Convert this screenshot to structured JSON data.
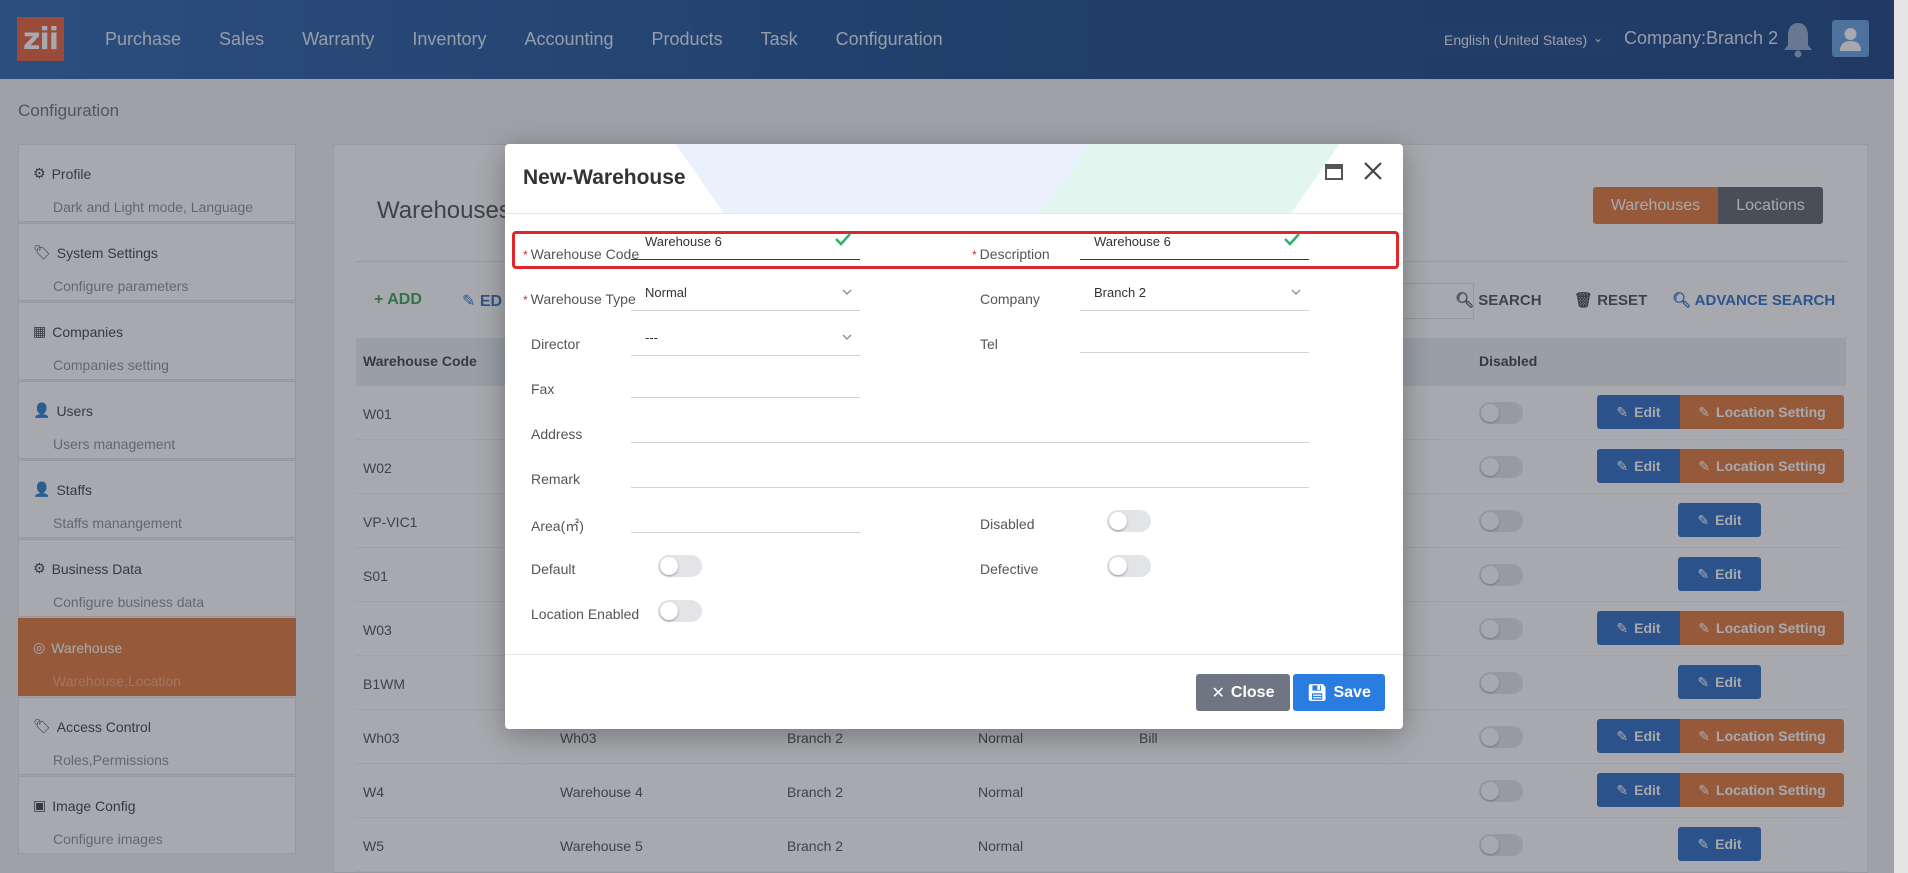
{
  "logo": "zii",
  "nav": [
    "Purchase",
    "Sales",
    "Warranty",
    "Inventory",
    "Accounting",
    "Products",
    "Task",
    "Configuration"
  ],
  "header": {
    "language": "English (United States)",
    "company": "Company:Branch 2"
  },
  "breadcrumb": "Configuration",
  "sidebar": [
    {
      "title": "Profile",
      "sub": "Dark and Light mode, Language"
    },
    {
      "title": "System Settings",
      "sub": "Configure parameters"
    },
    {
      "title": "Companies",
      "sub": "Companies setting"
    },
    {
      "title": "Users",
      "sub": "Users management"
    },
    {
      "title": "Staffs",
      "sub": "Staffs manangement"
    },
    {
      "title": "Business Data",
      "sub": "Configure business data"
    },
    {
      "title": "Warehouse",
      "sub": "Warehouse,Location"
    },
    {
      "title": "Access Control",
      "sub": "Roles,Permissions"
    },
    {
      "title": "Image Config",
      "sub": "Configure images"
    }
  ],
  "main": {
    "title": "Warehouses",
    "seg_warehouses": "Warehouses",
    "seg_locations": "Locations",
    "add": "ADD",
    "edit": "ED",
    "search": "SEARCH",
    "reset": "RESET",
    "advance": "ADVANCE SEARCH",
    "col_code": "Warehouse Code",
    "col_disabled": "Disabled",
    "edit_label": "Edit",
    "location_label": "Location Setting",
    "rows": [
      {
        "code": "W01",
        "desc": "",
        "company": "",
        "type": "",
        "director": "",
        "loc": true
      },
      {
        "code": "W02",
        "desc": "",
        "company": "",
        "type": "",
        "director": "",
        "loc": true
      },
      {
        "code": "VP-VIC1",
        "desc": "",
        "company": "",
        "type": "",
        "director": "",
        "loc": false
      },
      {
        "code": "S01",
        "desc": "",
        "company": "",
        "type": "",
        "director": "",
        "loc": false
      },
      {
        "code": "W03",
        "desc": "",
        "company": "",
        "type": "",
        "director": "",
        "loc": true
      },
      {
        "code": "B1WM",
        "desc": "",
        "company": "",
        "type": "",
        "director": "",
        "loc": false
      },
      {
        "code": "Wh03",
        "desc": "Wh03",
        "company": "Branch 2",
        "type": "Normal",
        "director": "Bill",
        "loc": true
      },
      {
        "code": "W4",
        "desc": "Warehouse 4",
        "company": "Branch 2",
        "type": "Normal",
        "director": "",
        "loc": true
      },
      {
        "code": "W5",
        "desc": "Warehouse 5",
        "company": "Branch 2",
        "type": "Normal",
        "director": "",
        "loc": false
      }
    ]
  },
  "modal": {
    "title": "New-Warehouse",
    "warehouse_code_label": "Warehouse Code",
    "warehouse_code_value": "Warehouse 6",
    "description_label": "Description",
    "description_value": "Warehouse 6",
    "warehouse_type_label": "Warehouse Type",
    "warehouse_type_value": "Normal",
    "company_label": "Company",
    "company_value": "Branch 2",
    "director_label": "Director",
    "director_value": "---",
    "tel_label": "Tel",
    "fax_label": "Fax",
    "address_label": "Address",
    "remark_label": "Remark",
    "area_label": "Area(㎡)",
    "disabled_label": "Disabled",
    "default_label": "Default",
    "defective_label": "Defective",
    "location_enabled_label": "Location Enabled",
    "close_label": "Close",
    "save_label": "Save"
  },
  "colors": {
    "brand": "#0c3f87",
    "accent": "#e0702f",
    "primary": "#2062c0",
    "success": "#2d9b4a",
    "danger": "#e0262a"
  }
}
